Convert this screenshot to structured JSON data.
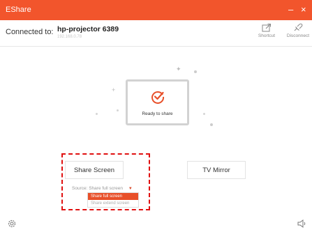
{
  "window": {
    "title": "EShare",
    "minimize_icon": "minimize-icon",
    "close_icon": "close-icon"
  },
  "header": {
    "connected_label": "Connected to:",
    "device_name": "hp-projector 6389",
    "device_ip": "192.168.0.78",
    "shortcut_label": "Shortcut",
    "disconnect_label": "Disconnect"
  },
  "main": {
    "ready_text": "Ready to share",
    "share_screen_label": "Share Screen",
    "tv_mirror_label": "TV Mirror",
    "source_label": "Source:",
    "source_value": "Share full screen",
    "dropdown_options": [
      "Share full screen",
      "Share extend screen"
    ],
    "selected_option_index": 0
  },
  "colors": {
    "accent": "#f2552c",
    "highlight_box": "#e01010"
  },
  "icons": [
    "settings-icon",
    "speaker-icon",
    "shortcut-icon",
    "disconnect-icon",
    "check-circle-icon"
  ]
}
